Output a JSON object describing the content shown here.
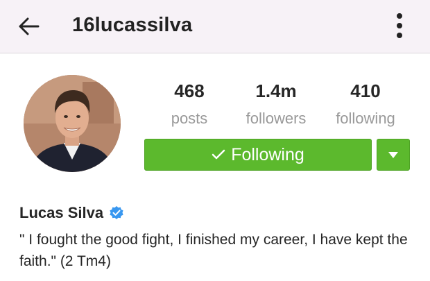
{
  "header": {
    "username": "16lucassilva",
    "back_icon": "arrow-left-icon",
    "menu_icon": "more-vertical-icon"
  },
  "profile": {
    "avatar_icon": "profile-photo",
    "display_name": "Lucas Silva",
    "verified_icon": "verified-badge-icon",
    "bio": "\" I fought the good fight, I finished my career, I have kept the faith.\" (2 Tm4)"
  },
  "stats": {
    "posts": {
      "value": "468",
      "label": "posts"
    },
    "followers": {
      "value": "1.4m",
      "label": "followers"
    },
    "following": {
      "value": "410",
      "label": "following"
    }
  },
  "actions": {
    "follow_label": "Following",
    "follow_icon": "checkmark-icon",
    "dropdown_icon": "caret-down-icon"
  },
  "colors": {
    "accent_green": "#5cb92d",
    "verified_blue": "#3897f0",
    "header_bg": "#f7f2f7",
    "muted_text": "#999999"
  }
}
